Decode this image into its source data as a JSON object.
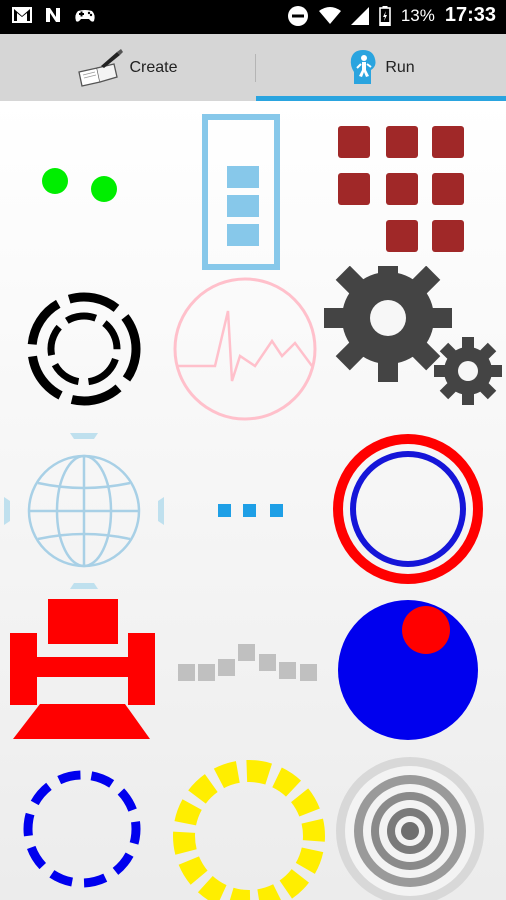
{
  "status_bar": {
    "left_icons": [
      "gmail-icon",
      "n-app-icon",
      "gamepad-icon"
    ],
    "right_icons": [
      "do-not-disturb-icon",
      "wifi-icon",
      "signal-icon",
      "battery-charging-icon"
    ],
    "battery": "13%",
    "time": "17:33"
  },
  "tabs": {
    "create_label": "Create",
    "run_label": "Run",
    "selected": "Run"
  },
  "colors": {
    "tab_indicator": "#2aa4df",
    "red": "#ff0000",
    "blue": "#0000ee",
    "green": "#00ee00",
    "light_blue": "#87c8ea",
    "dark_red": "#a02828",
    "yellow": "#ffee00",
    "gray": "#c0c0c0"
  },
  "grid": {
    "items": [
      "two-green-dots-icon",
      "blue-progress-bar-icon",
      "red-squares-grid-icon",
      "dashed-ring-black-icon",
      "heartbeat-circle-icon",
      "gears-icon",
      "globe-icon",
      "blue-dots-loader-icon",
      "red-blue-ring-icon",
      "red-hammer-shape-icon",
      "gray-wave-bars-icon",
      "blue-red-circle-icon",
      "blue-dashed-ring-icon",
      "yellow-sun-ring-icon",
      "gray-target-icon"
    ]
  }
}
